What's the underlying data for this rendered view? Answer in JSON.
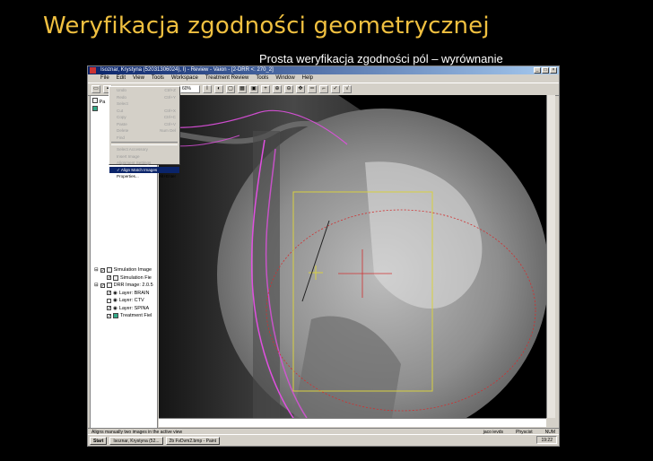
{
  "slide": {
    "title": "Weryfikacja zgodności geometrycznej",
    "subtitle": "Prosta weryfikacja zgodności pól – wyrównanie"
  },
  "window": {
    "title": "Isoznar, Krystyna (52031306024), I) - Review - Vaion - [2-DRR <: 270_2]",
    "buttons": [
      "_",
      "□",
      "×"
    ]
  },
  "menubar": [
    "File",
    "Edit",
    "View",
    "Tools",
    "Workspace",
    "Treatment Review",
    "Tools",
    "Window",
    "Help"
  ],
  "toolbar": {
    "zoom_value": "60%"
  },
  "context_menu": {
    "items": [
      {
        "label": "Undo",
        "shortcut": "Ctrl+Z",
        "enabled": false
      },
      {
        "label": "Redo",
        "shortcut": "Ctrl+Y",
        "enabled": false
      },
      {
        "label": "Select",
        "shortcut": "",
        "enabled": false
      },
      {
        "label": "Cut",
        "shortcut": "Ctrl+X",
        "enabled": false
      },
      {
        "label": "Copy",
        "shortcut": "Ctrl+C",
        "enabled": false
      },
      {
        "label": "Paste",
        "shortcut": "Ctrl+V",
        "enabled": false
      },
      {
        "label": "Delete",
        "shortcut": "Num Del",
        "enabled": false
      },
      {
        "label": "Find",
        "shortcut": "",
        "enabled": false
      },
      {
        "label": "Select Accessory",
        "shortcut": "",
        "enabled": false
      },
      {
        "label": "Insert Image",
        "shortcut": "",
        "enabled": false
      },
      {
        "label": "Alignment Settings",
        "shortcut": "",
        "enabled": false
      },
      {
        "label": "Align Match Images",
        "shortcut": "",
        "enabled": true,
        "selected": true
      },
      {
        "label": "Properties...",
        "shortcut": "Alt+Enter",
        "enabled": true
      }
    ]
  },
  "tree": [
    {
      "label": "Simulation Image",
      "level": 0
    },
    {
      "label": "Simulation Fie",
      "level": 1
    },
    {
      "label": "DRR Image: 2.0.5",
      "level": 0
    },
    {
      "label": "Layer: BRAIN",
      "level": 1
    },
    {
      "label": "Layer: CTV",
      "level": 1
    },
    {
      "label": "Layer: SPINA",
      "level": 1
    },
    {
      "label": "Treatment Fiel",
      "level": 1
    }
  ],
  "statusbar": {
    "left": "Aligns manually two images in the active view",
    "fields": [
      "jaco ievds",
      "Physcist",
      "NUM"
    ]
  },
  "taskbar": {
    "start": "Start",
    "buttons": [
      "Isoznar, Krystyna (52...",
      "2b FvDvm2.bmp - Paint"
    ],
    "clock": "19:22"
  },
  "colors": {
    "slide_title": "#f0c040",
    "contour_magenta": "#e050e0",
    "field_yellow": "#d8d040",
    "crosshair_red": "#d03030"
  }
}
